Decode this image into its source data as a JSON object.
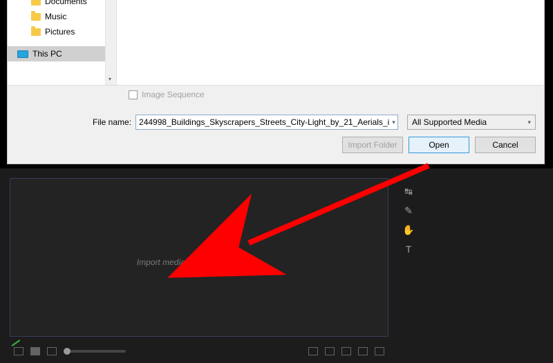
{
  "dialog": {
    "sidebar": {
      "items": [
        {
          "label": "Documents"
        },
        {
          "label": "Music"
        },
        {
          "label": "Pictures"
        }
      ],
      "root_label": "This PC"
    },
    "image_sequence_label": "Image Sequence",
    "filename_label": "File name:",
    "filename_value": "244998_Buildings_Skyscrapers_Streets_City-Light_by_21_Aerials_i",
    "type_value": "All Supported Media",
    "buttons": {
      "import_folder": "Import Folder",
      "open": "Open",
      "cancel": "Cancel"
    }
  },
  "premiere": {
    "hint": "Import media to start"
  },
  "annotation": {
    "color": "#ff0000"
  }
}
